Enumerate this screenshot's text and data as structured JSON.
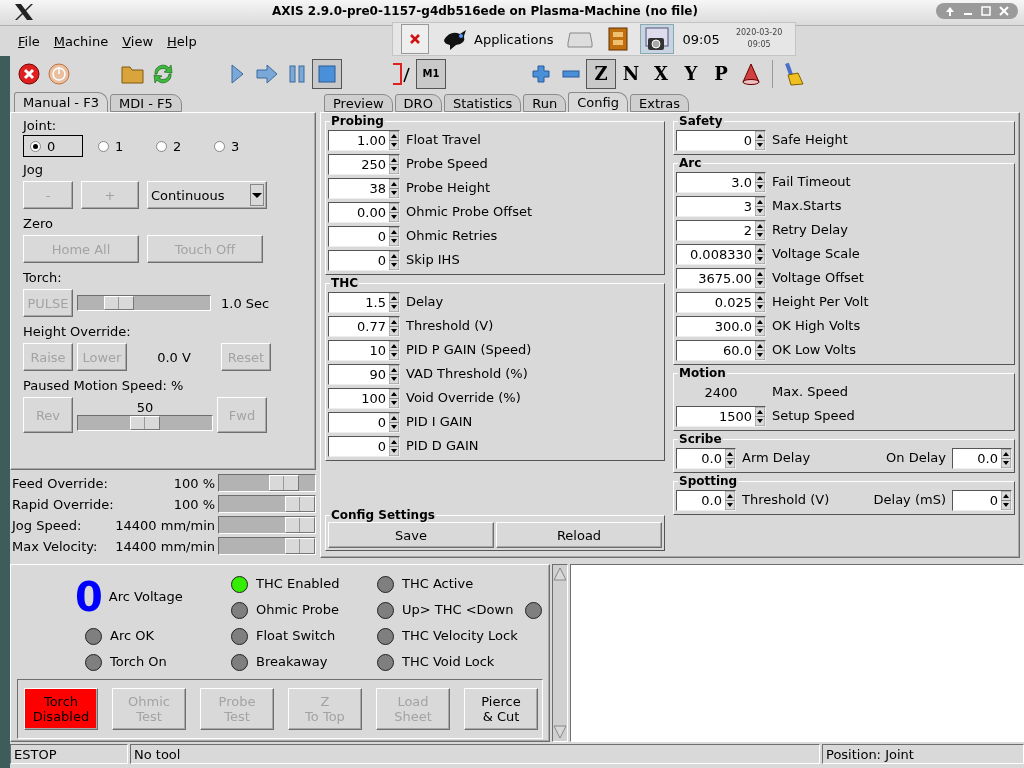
{
  "window": {
    "title": "AXIS 2.9.0-pre0-1157-g4db516ede on Plasma-Machine (no file)"
  },
  "panel": {
    "menu_label": "Applications",
    "clock": "09:05",
    "date": "2020-03-20",
    "date_time": "09:05"
  },
  "menu": [
    "File",
    "Machine",
    "View",
    "Help"
  ],
  "toolbar": {
    "stop_on": true,
    "optional_stop": {
      "label": "M1",
      "on": true
    },
    "views": [
      {
        "label": "Z",
        "selected": true
      },
      {
        "label": "N",
        "selected": false
      },
      {
        "label": "X",
        "selected": false
      },
      {
        "label": "Y",
        "selected": false
      },
      {
        "label": "P",
        "selected": false
      }
    ]
  },
  "manual_tabs": [
    {
      "label": "Manual - F3",
      "selected": true
    },
    {
      "label": "MDI - F5",
      "selected": false
    }
  ],
  "manual": {
    "joint_label": "Joint:",
    "joints": [
      {
        "label": "0",
        "selected": true
      },
      {
        "label": "1",
        "selected": false
      },
      {
        "label": "2",
        "selected": false
      },
      {
        "label": "3",
        "selected": false
      }
    ],
    "jog_label": "Jog",
    "jog_buttons": [
      {
        "label": "-",
        "disabled": true
      },
      {
        "label": "+",
        "disabled": true
      }
    ],
    "jog_mode": "Continuous",
    "zero_label": "Zero",
    "zero_buttons": [
      {
        "label": "Home All",
        "disabled": true
      },
      {
        "label": "Touch Off",
        "disabled": true
      }
    ],
    "torch_label": "Torch:",
    "pulse": {
      "label": "PULSE",
      "disabled": true
    },
    "pulse_slider": {
      "level": 0.25
    },
    "pulse_reading": "1.0 Sec",
    "height_label": "Height Override:",
    "raise": {
      "label": "Raise",
      "disabled": true
    },
    "lower": {
      "label": "Lower",
      "disabled": true
    },
    "height_reading": "0.0 V",
    "reset": {
      "label": "Reset",
      "disabled": true
    },
    "paused_label": "Paused Motion Speed: %",
    "rev": {
      "label": "Rev",
      "disabled": true
    },
    "fwd": {
      "label": "Fwd",
      "disabled": true
    },
    "paused_reading": "50",
    "paused_slider": {
      "level": 0.5
    }
  },
  "overrides": [
    {
      "label": "Feed Override:",
      "reading": "100 %",
      "level": 0.75
    },
    {
      "label": "Rapid Override:",
      "reading": "100 %",
      "level": 1
    },
    {
      "label": "Jog Speed:",
      "reading": "14400 mm/min",
      "level": 1
    },
    {
      "label": "Max Velocity:",
      "reading": "14400 mm/min",
      "level": 1
    }
  ],
  "config_tabs": [
    {
      "label": "Preview",
      "selected": false
    },
    {
      "label": "DRO",
      "selected": false
    },
    {
      "label": "Statistics",
      "selected": false
    },
    {
      "label": "Run",
      "selected": false
    },
    {
      "label": "Config",
      "selected": true
    },
    {
      "label": "Extras",
      "selected": false
    }
  ],
  "config": {
    "left_groups": [
      {
        "title": "Probing",
        "rows": [
          {
            "kind": "spin",
            "value": "1.00",
            "label": "Float Travel"
          },
          {
            "kind": "spin",
            "value": "250",
            "label": "Probe Speed"
          },
          {
            "kind": "spin",
            "value": "38",
            "label": "Probe Height"
          },
          {
            "kind": "spin",
            "value": "0.00",
            "label": "Ohmic Probe Offset"
          },
          {
            "kind": "spin",
            "value": "0",
            "label": "Ohmic Retries"
          },
          {
            "kind": "spin",
            "value": "0",
            "label": "Skip IHS"
          }
        ]
      },
      {
        "title": "THC",
        "rows": [
          {
            "kind": "spin",
            "value": "1.5",
            "label": "Delay"
          },
          {
            "kind": "spin",
            "value": "0.77",
            "label": "Threshold (V)"
          },
          {
            "kind": "spin",
            "value": "10",
            "label": "PID P GAIN (Speed)"
          },
          {
            "kind": "spin",
            "value": "90",
            "label": "VAD Threshold (%)"
          },
          {
            "kind": "spin",
            "value": "100",
            "label": "Void Override (%)"
          },
          {
            "kind": "spin",
            "value": "0",
            "label": "PID I GAIN"
          },
          {
            "kind": "spin",
            "value": "0",
            "label": "PID D GAIN"
          }
        ]
      }
    ],
    "right_groups": [
      {
        "title": "Safety",
        "rows": [
          {
            "kind": "spin",
            "value": "0",
            "label": "Safe Height"
          }
        ]
      },
      {
        "title": "Arc",
        "rows": [
          {
            "kind": "spin",
            "value": "3.0",
            "label": "Fail Timeout"
          },
          {
            "kind": "spin",
            "value": "3",
            "label": "Max.Starts"
          },
          {
            "kind": "spin",
            "value": "2",
            "label": "Retry Delay"
          },
          {
            "kind": "spin",
            "value": "0.008330",
            "label": "Voltage Scale"
          },
          {
            "kind": "spin",
            "value": "3675.00",
            "label": "Voltage Offset"
          },
          {
            "kind": "spin",
            "value": "0.025",
            "label": "Height Per Volt"
          },
          {
            "kind": "spin",
            "value": "300.0",
            "label": "OK High Volts"
          },
          {
            "kind": "spin",
            "value": "60.0",
            "label": "OK Low Volts"
          }
        ]
      },
      {
        "title": "Motion",
        "rows": [
          {
            "kind": "static",
            "value": "2400",
            "label": "Max. Speed"
          },
          {
            "kind": "spin",
            "value": "1500",
            "label": "Setup Speed"
          }
        ]
      },
      {
        "title": "Scribe",
        "rows": [
          {
            "kind": "pair",
            "value": "0.0",
            "label": "Arm Delay",
            "label2": "On Delay",
            "value2": "0.0"
          }
        ]
      },
      {
        "title": "Spotting",
        "rows": [
          {
            "kind": "pair",
            "value": "0.0",
            "label": "Threshold (V)",
            "label2": "Delay (mS)",
            "value2": "0"
          }
        ]
      }
    ],
    "settings": {
      "title": "Config Settings",
      "buttons": [
        "Save",
        "Reload"
      ]
    }
  },
  "plasma": {
    "arc_voltage": {
      "value": "0",
      "label": "Arc Voltage"
    },
    "led_columns": [
      [
        {
          "kind": "single",
          "label": "Arc OK",
          "on": false
        },
        {
          "kind": "single",
          "label": "Torch On",
          "on": false
        }
      ],
      [
        {
          "kind": "single",
          "label": "THC Enabled",
          "on": true
        },
        {
          "kind": "single",
          "label": "Ohmic Probe",
          "on": false
        },
        {
          "kind": "single",
          "label": "Float Switch",
          "on": false
        },
        {
          "kind": "single",
          "label": "Breakaway",
          "on": false
        }
      ],
      [
        {
          "kind": "single",
          "label": "THC Active",
          "on": false
        },
        {
          "kind": "dual",
          "label": "Up> THC <Down",
          "on": false,
          "on_right": false
        },
        {
          "kind": "single",
          "label": "THC Velocity Lock",
          "on": false
        },
        {
          "kind": "single",
          "label": "THC Void Lock",
          "on": false
        }
      ]
    ],
    "buttons": [
      {
        "lines": [
          "Torch",
          "Disabled"
        ],
        "kind": "alert",
        "disabled": false
      },
      {
        "lines": [
          "Ohmic",
          "Test"
        ],
        "kind": "normal",
        "disabled": true
      },
      {
        "lines": [
          "Probe",
          "Test"
        ],
        "kind": "normal",
        "disabled": true
      },
      {
        "lines": [
          "Z",
          "To Top"
        ],
        "kind": "normal",
        "disabled": true
      },
      {
        "lines": [
          "Load",
          "Sheet"
        ],
        "kind": "normal",
        "disabled": true
      },
      {
        "lines": [
          "Pierce",
          "& Cut"
        ],
        "kind": "normal",
        "disabled": false
      }
    ]
  },
  "status_bar": [
    {
      "kind": "state",
      "text": "ESTOP"
    },
    {
      "kind": "tool",
      "text": "No tool"
    },
    {
      "kind": "position",
      "text": "Position: Joint"
    }
  ]
}
